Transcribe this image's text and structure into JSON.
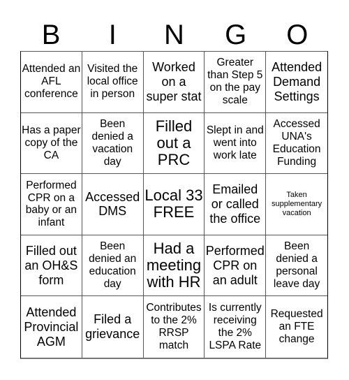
{
  "header": {
    "letters": [
      "B",
      "I",
      "N",
      "G",
      "O"
    ]
  },
  "cells": [
    [
      "Attended an AFL conference",
      "Visited the local office in person",
      "Worked on a super stat",
      "Greater than Step 5 on the pay scale",
      "Attended Demand Settings"
    ],
    [
      "Has a paper copy of the CA",
      "Been denied a vacation day",
      "Filled out a PRC",
      "Slept in and went into work late",
      "Accessed UNA's Education Funding"
    ],
    [
      "Performed CPR on a baby or an infant",
      "Accessed DMS",
      "Local 33 FREE",
      "Emailed or called the office",
      "Taken supplementary vacation"
    ],
    [
      "Filled out an OH&S form",
      "Been denied an education day",
      "Had a meeting with HR",
      "Performed CPR on an adult",
      "Been denied a personal leave day"
    ],
    [
      "Attended Provincial AGM",
      "Filed a grievance",
      "Contributes to the 2% RRSP match",
      "Is currently receiving the 2% LSPA Rate",
      "Requested an FTE change"
    ]
  ],
  "free_space": {
    "row": 2,
    "col": 2
  }
}
